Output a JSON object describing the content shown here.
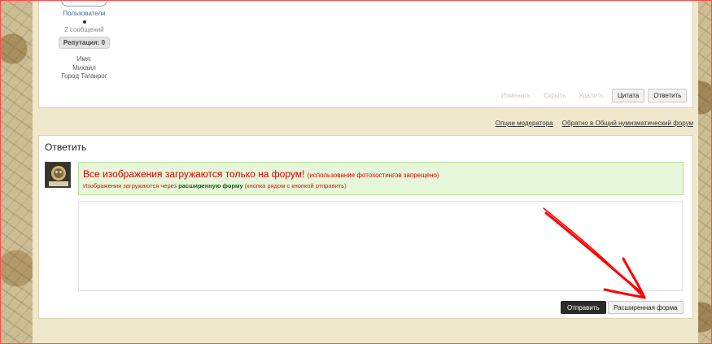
{
  "post": {
    "user_group": "Пользователи",
    "posts_count": "2 сообщений",
    "reputation": "Репутация: 0",
    "name_label": "Имя:",
    "name_value": "Михаил",
    "city_label": "Город",
    "city_value": "Таганрог",
    "actions": {
      "edit": "Изменить",
      "hide": "Скрыть",
      "delete": "Удалить",
      "quote": "Цитата",
      "reply": "Ответить"
    }
  },
  "moderator_links": {
    "options": "Опции модератора",
    "separator": "·",
    "back": "Обратно в Общий нумизматический форум"
  },
  "reply_box": {
    "title": "Ответить",
    "notice_heading": "Все изображения загружаются только на форум!",
    "notice_heading_note": "(использование фотохостингов запрещено)",
    "notice_sub_prefix": "Изображения загружаются через",
    "notice_sub_bold": "расширенную форму",
    "notice_sub_suffix": "(кнопка рядом с кнопкой отправить)",
    "editor_value": "",
    "submit_label": "Отправить",
    "extended_label": "Расширенная форма"
  },
  "colors": {
    "accent_red": "#dd0000",
    "notice_bg": "#e6f6d8",
    "annotation_arrow": "#ff0000"
  }
}
